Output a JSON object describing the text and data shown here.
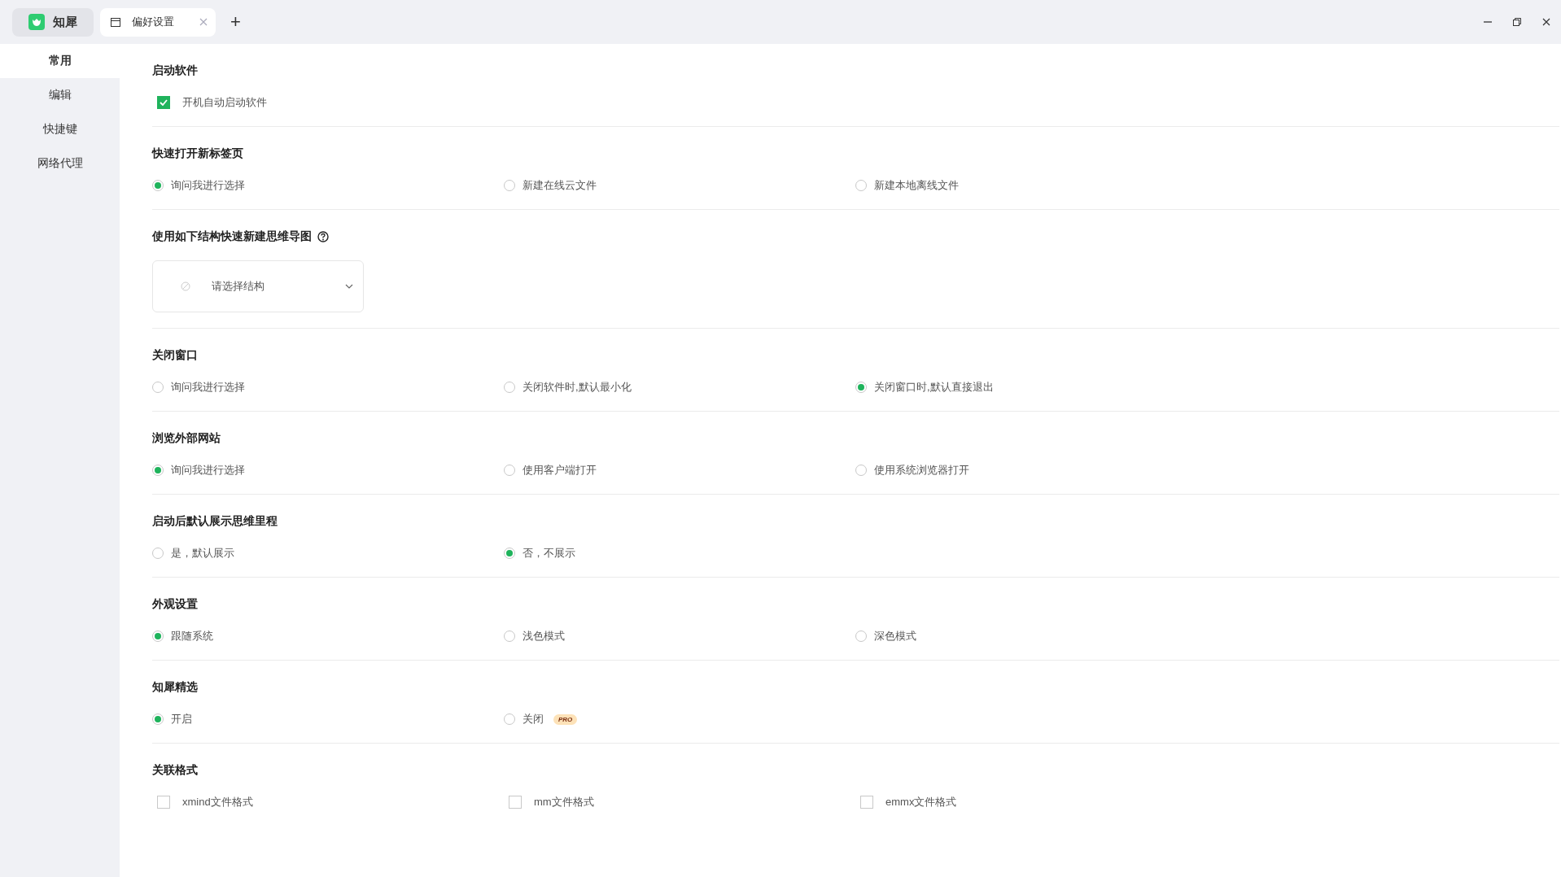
{
  "titlebar": {
    "app": {
      "label": "知犀",
      "selected": false
    },
    "tabs": [
      {
        "label": "偏好设置",
        "selected": true
      }
    ],
    "new_tab": "+"
  },
  "sidebar": {
    "items": [
      {
        "label": "常用",
        "selected": true
      },
      {
        "label": "编辑",
        "selected": false
      },
      {
        "label": "快捷键",
        "selected": false
      },
      {
        "label": "网络代理",
        "selected": false
      }
    ]
  },
  "sections": [
    {
      "title": "启动软件",
      "kind": "checkbox",
      "options": [
        {
          "label": "开机自动启动软件",
          "checked": true
        }
      ]
    },
    {
      "title": "快速打开新标签页",
      "kind": "radio",
      "options": [
        {
          "label": "询问我进行选择",
          "selected": true
        },
        {
          "label": "新建在线云文件",
          "selected": false
        },
        {
          "label": "新建本地离线文件",
          "selected": false
        }
      ]
    },
    {
      "title": "使用如下结构快速新建思维导图",
      "kind": "select",
      "help": true,
      "placeholder": "请选择结构"
    },
    {
      "title": "关闭窗口",
      "kind": "radio",
      "options": [
        {
          "label": "询问我进行选择",
          "selected": false
        },
        {
          "label": "关闭软件时,默认最小化",
          "selected": false
        },
        {
          "label": "关闭窗口时,默认直接退出",
          "selected": true
        }
      ]
    },
    {
      "title": "浏览外部网站",
      "kind": "radio",
      "options": [
        {
          "label": "询问我进行选择",
          "selected": true
        },
        {
          "label": "使用客户端打开",
          "selected": false
        },
        {
          "label": "使用系统浏览器打开",
          "selected": false
        }
      ]
    },
    {
      "title": "启动后默认展示思维里程",
      "kind": "radio",
      "options": [
        {
          "label": "是，默认展示",
          "selected": false
        },
        {
          "label": "否，不展示",
          "selected": true
        }
      ]
    },
    {
      "title": "外观设置",
      "kind": "radio",
      "options": [
        {
          "label": "跟随系统",
          "selected": true
        },
        {
          "label": "浅色模式",
          "selected": false
        },
        {
          "label": "深色模式",
          "selected": false
        }
      ]
    },
    {
      "title": "知犀精选",
      "kind": "radio",
      "options": [
        {
          "label": "开启",
          "selected": true
        },
        {
          "label": "关闭",
          "selected": false,
          "badge": "PRO"
        }
      ]
    },
    {
      "title": "关联格式",
      "kind": "checkbox",
      "options": [
        {
          "label": "xmind文件格式",
          "checked": false
        },
        {
          "label": "mm文件格式",
          "checked": false
        },
        {
          "label": "emmx文件格式",
          "checked": false
        }
      ]
    }
  ]
}
